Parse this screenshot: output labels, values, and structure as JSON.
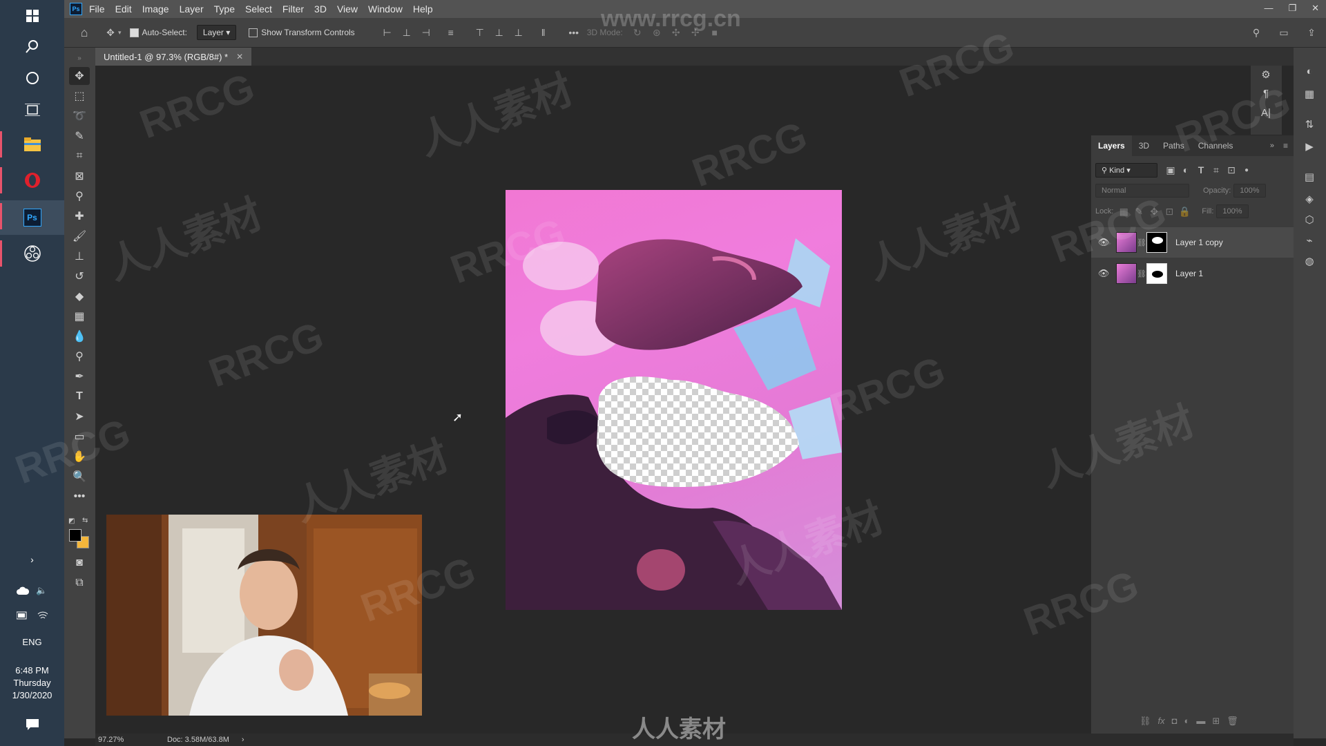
{
  "taskbar": {
    "time": "6:48 PM",
    "day": "Thursday",
    "date": "1/30/2020",
    "language": "ENG",
    "icons": [
      "windows-icon",
      "search-icon",
      "cortana-icon",
      "task-view-icon",
      "file-explorer-icon",
      "opera-icon",
      "photoshop-icon",
      "obs-icon"
    ]
  },
  "menubar": {
    "app_icon": "Ps",
    "items": [
      "File",
      "Edit",
      "Image",
      "Layer",
      "Type",
      "Select",
      "Filter",
      "3D",
      "View",
      "Window",
      "Help"
    ]
  },
  "options": {
    "auto_select_label": "Auto-Select:",
    "auto_select_checked": true,
    "auto_select_target": "Layer",
    "show_transform_label": "Show Transform Controls",
    "show_transform_checked": false,
    "mode_3d_label": "3D Mode:"
  },
  "document": {
    "tab_title": "Untitled-1 @ 97.3% (RGB/8#) *",
    "zoom": "97.27%",
    "doc_size": "Doc: 3.58M/63.8M"
  },
  "layers_panel": {
    "tabs": [
      "Layers",
      "3D",
      "Paths",
      "Channels"
    ],
    "active_tab": "Layers",
    "filter_kind": "Kind",
    "blend_mode": "Normal",
    "opacity_label": "Opacity:",
    "opacity_value": "100%",
    "lock_label": "Lock:",
    "fill_label": "Fill:",
    "fill_value": "100%",
    "layers": [
      {
        "name": "Layer 1 copy",
        "visible": true
      },
      {
        "name": "Layer 1",
        "visible": true
      }
    ]
  },
  "watermarks": {
    "site": "www.rrcg.cn",
    "brand": "RRCG",
    "cn": "人人素材"
  },
  "colors": {
    "foreground": "#000000",
    "background": "#f4b63b",
    "canvas_pink": "#f07ddd"
  }
}
